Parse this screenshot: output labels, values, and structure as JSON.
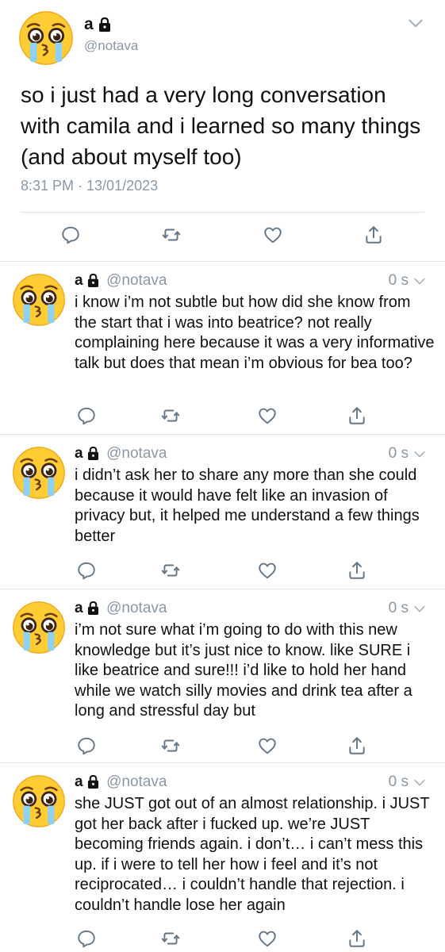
{
  "account": {
    "name": "a",
    "handle": "@notava",
    "avatar_emoji": "crying-pleading-face"
  },
  "main_tweet": {
    "text": "so i just had a very long conversation with camila and i learned so many things (and about myself too)",
    "timestamp": "8:31 PM · 13/01/2023",
    "actions": [
      "reply-icon",
      "retweet-icon",
      "like-icon",
      "share-icon"
    ]
  },
  "replies": [
    {
      "name": "a",
      "handle": "@notava",
      "time": "0 s",
      "text": "i know i’m not subtle but how did she know from the start that i was into beatrice? not really complaining here because it was a very informative talk but does that mean i’m obvious for bea too?"
    },
    {
      "name": "a",
      "handle": "@notava",
      "time": "0 s",
      "text": "i didn’t ask her to share any more than she could because it would have felt like an invasion of privacy but, it helped me understand a few things better"
    },
    {
      "name": "a",
      "handle": "@notava",
      "time": "0 s",
      "text": "i’m not sure what i’m going to do with this new knowledge but it’s just nice to know. like SURE i like beatrice and sure!!! i’d like to hold her hand while we watch silly movies and drink tea after a long and stressful day but"
    },
    {
      "name": "a",
      "handle": "@notava",
      "time": "0 s",
      "text": "she JUST got out of an almost relationship. i JUST got her back after i fucked up. we’re JUST becoming friends again. i don’t… i can’t mess this up. if i were to tell her how i feel and it’s not reciprocated… i couldn’t handle that rejection. i couldn’t handle lose her again"
    }
  ],
  "colors": {
    "text": "#0f1419",
    "secondary": "#8b98a5",
    "icon": "#657786",
    "divider": "#dfe3e6"
  }
}
